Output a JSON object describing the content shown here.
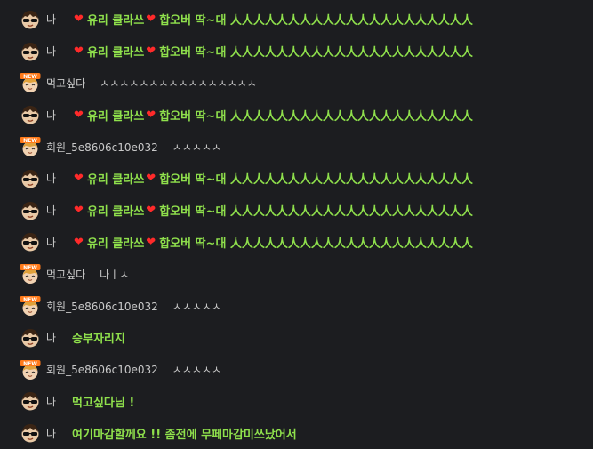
{
  "chat": {
    "messages": [
      {
        "type": "me",
        "avatar": "sunglasses-avatar-icon",
        "nick": "나",
        "heart": "❤",
        "part1": "유리 클라쓰",
        "part2": "합오버 딱~대 人人人人人人人人人人人人人人人人人人人人人"
      },
      {
        "type": "me",
        "avatar": "sunglasses-avatar-icon",
        "nick": "나",
        "heart": "❤",
        "part1": "유리 클라쓰",
        "part2": "합오버 딱~대 人人人人人人人人人人人人人人人人人人人人人"
      },
      {
        "type": "other",
        "avatar": "new-avatar-icon",
        "nick": "먹고싶다",
        "text": "ㅅㅅㅅㅅㅅㅅㅅㅅㅅㅅㅅㅅㅅㅅㅅㅅ"
      },
      {
        "type": "me",
        "avatar": "sunglasses-avatar-icon",
        "nick": "나",
        "heart": "❤",
        "part1": "유리 클라쓰",
        "part2": "합오버 딱~대 人人人人人人人人人人人人人人人人人人人人人"
      },
      {
        "type": "other",
        "avatar": "new-avatar-icon",
        "nick": "회원_5e8606c10e032",
        "text": "ㅅㅅㅅㅅㅅ"
      },
      {
        "type": "me",
        "avatar": "sunglasses-avatar-icon",
        "nick": "나",
        "heart": "❤",
        "part1": "유리 클라쓰",
        "part2": "합오버 딱~대 人人人人人人人人人人人人人人人人人人人人人"
      },
      {
        "type": "me",
        "avatar": "sunglasses-avatar-icon",
        "nick": "나",
        "heart": "❤",
        "part1": "유리 클라쓰",
        "part2": "합오버 딱~대 人人人人人人人人人人人人人人人人人人人人人"
      },
      {
        "type": "me",
        "avatar": "sunglasses-avatar-icon",
        "nick": "나",
        "heart": "❤",
        "part1": "유리 클라쓰",
        "part2": "합오버 딱~대 人人人人人人人人人人人人人人人人人人人人人"
      },
      {
        "type": "other",
        "avatar": "new-avatar-icon",
        "nick": "먹고싶다",
        "text": "나ㅣㅅ"
      },
      {
        "type": "other",
        "avatar": "new-avatar-icon",
        "nick": "회원_5e8606c10e032",
        "text": "ㅅㅅㅅㅅㅅ"
      },
      {
        "type": "me",
        "avatar": "sunglasses-avatar-icon",
        "nick": "나",
        "text": "승부자리지"
      },
      {
        "type": "other",
        "avatar": "new-avatar-icon",
        "nick": "회원_5e8606c10e032",
        "text": "ㅅㅅㅅㅅㅅ"
      },
      {
        "type": "me",
        "avatar": "sunglasses-avatar-icon",
        "nick": "나",
        "text": "먹고싶다님 !"
      },
      {
        "type": "me",
        "avatar": "sunglasses-avatar-icon",
        "nick": "나",
        "text": "여기마감할께요 !! 좀전에 무페마감미쓰났어서"
      }
    ]
  },
  "colors": {
    "background": "#1c1d20",
    "my_message": "#8fe04c",
    "other_message": "#c9c9c9",
    "heart": "#ff2a2a",
    "new_badge": "#ff7a1a"
  }
}
